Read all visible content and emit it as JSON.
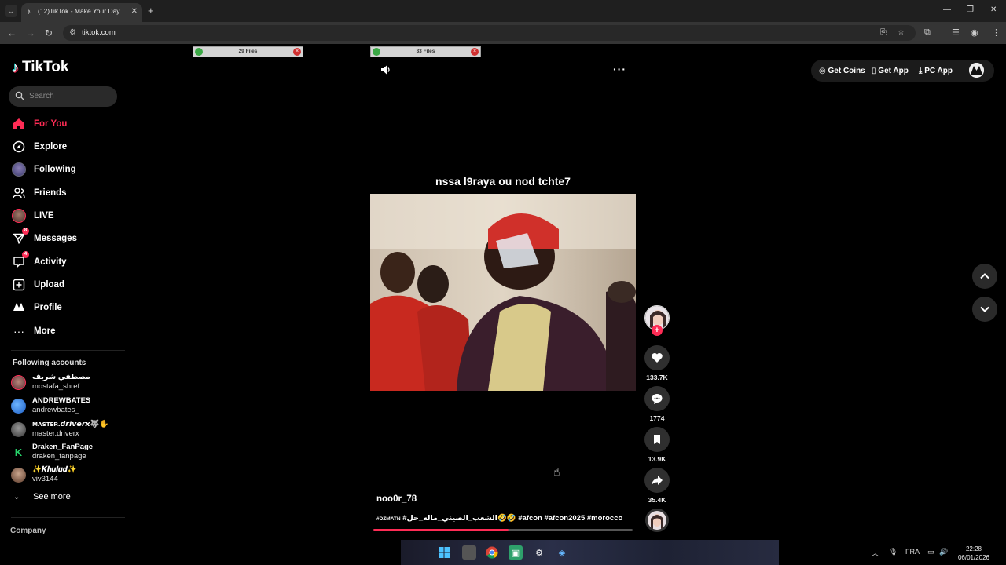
{
  "browser": {
    "tab_title": "(12)TikTok - Make Your Day",
    "url": "tiktok.com"
  },
  "downloads": [
    {
      "label": "29 Files"
    },
    {
      "label": "33 Files"
    }
  ],
  "sidebar": {
    "logo": "TikTok",
    "search_placeholder": "Search",
    "menu": [
      {
        "label": "For You",
        "icon": "home-icon",
        "active": true
      },
      {
        "label": "Explore",
        "icon": "compass-icon"
      },
      {
        "label": "Following",
        "icon": "following-avatar-icon"
      },
      {
        "label": "Friends",
        "icon": "friends-icon"
      },
      {
        "label": "LIVE",
        "icon": "live-icon"
      },
      {
        "label": "Messages",
        "icon": "messages-icon",
        "badge": "8"
      },
      {
        "label": "Activity",
        "icon": "activity-icon",
        "badge": "4"
      },
      {
        "label": "Upload",
        "icon": "upload-icon"
      },
      {
        "label": "Profile",
        "icon": "profile-icon"
      },
      {
        "label": "More",
        "icon": "more-icon"
      }
    ],
    "following_title": "Following accounts",
    "accounts": [
      {
        "name": "مصطفي شريف",
        "handle": "mostafa_shref"
      },
      {
        "name": "ANDREWBATES",
        "handle": "andrewbates_"
      },
      {
        "name": "ᴍᴀsᴛᴇʀ.𝙙𝙧𝙞𝙫𝙚𝙧𝙭🐺✋",
        "handle": "master.driverx"
      },
      {
        "name": "Draken_FanPage",
        "handle": "draken_fanpage"
      },
      {
        "name": "✨𝑲𝒉𝒖𝒍𝒖𝒅✨",
        "handle": "viv3144"
      }
    ],
    "see_more": "See more",
    "company": "Company"
  },
  "header": {
    "get_coins": "Get Coins",
    "get_app": "Get App",
    "pc_app": "PC App"
  },
  "video": {
    "caption_overlay": "nssa l9raya ou nod tchte7",
    "author": "noo0r_78",
    "desc_tag": "#DZMATN",
    "desc_rest": " #الشعب_الصيني_ماله_حل🤣🤣 #afcon #afcon2025 #morocco",
    "progress": 0.52,
    "likes": "133.7K",
    "comments": "1774",
    "saves": "13.9K",
    "shares": "35.4K"
  },
  "taskbar": {
    "language": "FRA",
    "time": "22:28",
    "date": "06/01/2026"
  },
  "colors": {
    "accent": "#fe2c55",
    "background": "#000000"
  }
}
